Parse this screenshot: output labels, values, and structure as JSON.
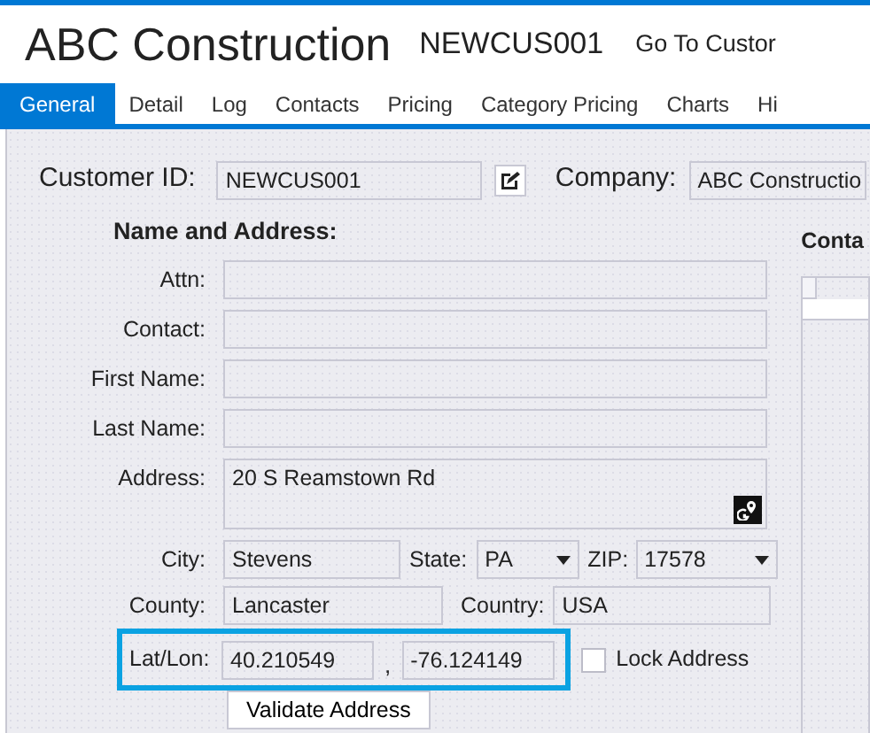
{
  "header": {
    "title": "ABC Construction",
    "code": "NEWCUS001",
    "link": "Go To Custor"
  },
  "tabs": [
    {
      "label": "General",
      "selected": true
    },
    {
      "label": "Detail",
      "selected": false
    },
    {
      "label": "Log",
      "selected": false
    },
    {
      "label": "Contacts",
      "selected": false
    },
    {
      "label": "Pricing",
      "selected": false
    },
    {
      "label": "Category Pricing",
      "selected": false
    },
    {
      "label": "Charts",
      "selected": false
    },
    {
      "label": "Hi",
      "selected": false
    }
  ],
  "customer_id": {
    "label": "Customer ID:",
    "value": "NEWCUS001"
  },
  "company": {
    "label": "Company:",
    "value": "ABC Constructio"
  },
  "name_address": {
    "heading": "Name and Address:",
    "fields": [
      {
        "label": "Attn:",
        "kind": "line"
      },
      {
        "label": "Contact:",
        "kind": "line"
      },
      {
        "label": "First Name:",
        "kind": "line"
      },
      {
        "label": "Last Name:",
        "kind": "line"
      },
      {
        "label": "Address:",
        "value": "20 S Reamstown Rd",
        "kind": "multiline"
      }
    ],
    "city": {
      "label": "City:",
      "value": "Stevens"
    },
    "state": {
      "label": "State:",
      "value": "PA"
    },
    "zip": {
      "label": "ZIP:",
      "value": "17578"
    },
    "county": {
      "label": "County:",
      "value": "Lancaster"
    },
    "country": {
      "label": "Country:",
      "value": "USA"
    },
    "latlon": {
      "label": "Lat/Lon:",
      "lat": "40.210549",
      "separator": ",",
      "lon": "-76.124149"
    },
    "lock_address": {
      "label": "Lock Address",
      "checked": false
    },
    "validate_button": "Validate Address"
  },
  "side_panel": {
    "title": "Conta"
  }
}
